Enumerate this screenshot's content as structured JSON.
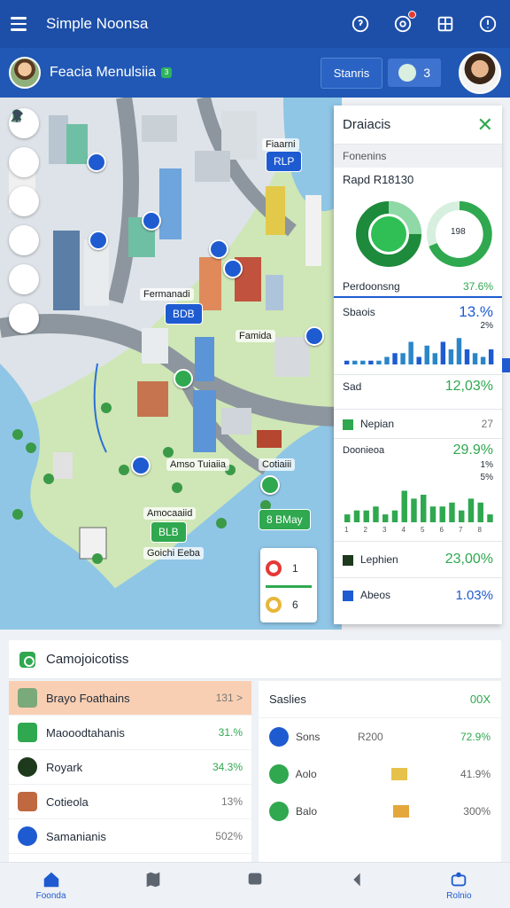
{
  "appbar": {
    "title": "Simple Noonsa",
    "icons": [
      "menu-icon",
      "help-icon",
      "notification-icon",
      "map-icon",
      "settings-icon"
    ]
  },
  "subbar": {
    "place": "Feacia Menulsiia",
    "badge": "3",
    "status_label": "Stanris",
    "count_label": "3"
  },
  "map": {
    "labels": {
      "l1": "Fiaarni",
      "l2": "Fermanadi",
      "l3": "Famida",
      "l4": "Amso Tuiaiia",
      "l5": "Cotiaiii",
      "l6": "Amocaaiid",
      "l7": "Goichi Eeba"
    },
    "chips": {
      "c1": "RLP",
      "c2": "BDB",
      "c3": "8 BMay",
      "c4": "BLB"
    },
    "legend": {
      "a": "1",
      "b": "6"
    }
  },
  "panel": {
    "title": "Draiacis",
    "section": "Fonenins",
    "pv_title": "Rapd R18130",
    "donut_center": "198",
    "perf_label": "Perdoonsng",
    "perf_value": "37.6%",
    "s1_label": "Sbaois",
    "s1_value": "13.%",
    "s1_small": "2%",
    "s2_label": "Sad",
    "s2_value": "12,03%",
    "s3_label": "Nepian",
    "s3_value": "27",
    "s4_label": "Doonieoa",
    "s4_value": "29.9%",
    "s4_small": "1%",
    "s4_small2": "5%",
    "s5_label": "Lephien",
    "s5_value": "23,00%",
    "s6_label": "Abeos",
    "s6_value": "1.03%",
    "axis": [
      "1",
      "2",
      "3",
      "4",
      "5",
      "6",
      "7",
      "8"
    ]
  },
  "chart_data": [
    {
      "type": "bar",
      "title": "",
      "values": [
        1,
        1,
        1,
        1,
        1,
        2,
        3,
        3,
        6,
        2,
        5,
        3,
        6,
        4,
        7,
        4,
        3,
        2,
        4
      ],
      "xlabel": "",
      "ylabel": ""
    },
    {
      "type": "bar",
      "title": "",
      "values": [
        2,
        3,
        3,
        4,
        2,
        3,
        8,
        6,
        7,
        4,
        4,
        5,
        3,
        6,
        5,
        2
      ],
      "xlabel": "",
      "ylabel": ""
    }
  ],
  "lower": {
    "title": "Camojoicotiss",
    "left_items": [
      {
        "label": "Brayo Foathains",
        "value": "131 >",
        "active": true,
        "color": "#7aa97a"
      },
      {
        "label": "Maooodtahanis",
        "value": "31.%",
        "active": false,
        "color": "#2fa84f"
      },
      {
        "label": "Royark",
        "value": "34.3%",
        "active": false,
        "color": "#1d3a1d"
      },
      {
        "label": "Cotieola",
        "value": "13%",
        "active": false,
        "color": "#c06840",
        "gray": true
      },
      {
        "label": "Samanianis",
        "value": "502%",
        "active": false,
        "color": "#1e5bd1",
        "gray": true
      }
    ],
    "right_title": "Saslies",
    "right_value": "00X",
    "right_rows": [
      {
        "label": "Sons",
        "mid": "R200",
        "pct": "72.9%",
        "green": true,
        "circle": "#1e5bd1",
        "sq": "#d58dc9"
      },
      {
        "label": "Aolo",
        "mid": "",
        "pct": "41.9%",
        "green": false,
        "circle": "#2fa84f",
        "sq": "#e7c24a"
      },
      {
        "label": "Balo",
        "mid": "",
        "pct": "300%",
        "green": false,
        "circle": "#2fa84f",
        "sq": "#e4a73c"
      }
    ]
  },
  "bottomnav": [
    {
      "label": "Foonda",
      "icon": "home-icon"
    },
    {
      "label": "",
      "icon": "map-icon"
    },
    {
      "label": "",
      "icon": "location-icon"
    },
    {
      "label": "",
      "icon": "back-icon"
    },
    {
      "label": "Rolnio",
      "icon": "profile-icon"
    }
  ],
  "colors": {
    "primary": "#1d4fa8",
    "accent": "#2fa84f",
    "blue": "#1e5bd1"
  }
}
